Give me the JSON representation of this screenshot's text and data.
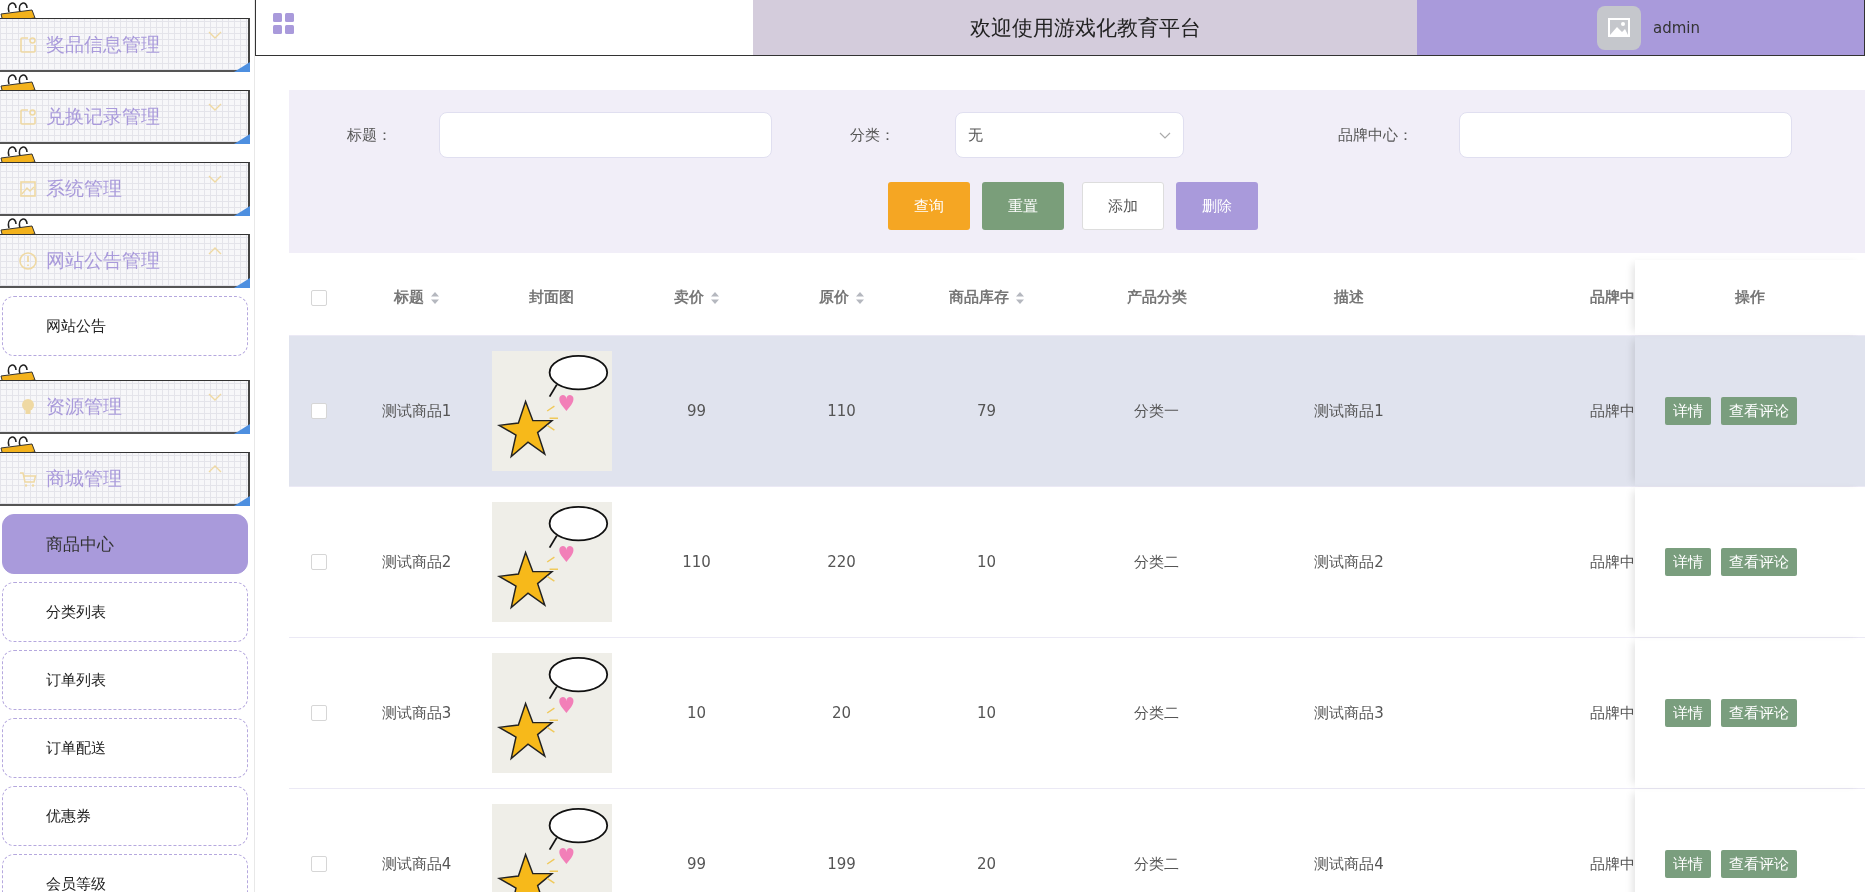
{
  "header": {
    "title": "欢迎使用游戏化教育平台",
    "user": "admin"
  },
  "sidebar": {
    "groups": [
      {
        "label": "奖品信息管理",
        "expanded": false
      },
      {
        "label": "兑换记录管理",
        "expanded": false
      },
      {
        "label": "系统管理",
        "expanded": false
      },
      {
        "label": "网站公告管理",
        "expanded": true,
        "children": [
          {
            "label": "网站公告",
            "selected": false
          }
        ]
      },
      {
        "label": "资源管理",
        "expanded": false
      },
      {
        "label": "商城管理",
        "expanded": true,
        "children": [
          {
            "label": "商品中心",
            "selected": true
          },
          {
            "label": "分类列表",
            "selected": false
          },
          {
            "label": "订单列表",
            "selected": false
          },
          {
            "label": "订单配送",
            "selected": false
          },
          {
            "label": "优惠券",
            "selected": false
          },
          {
            "label": "会员等级",
            "selected": false
          }
        ]
      }
    ]
  },
  "filter": {
    "fields": [
      {
        "kind": "input",
        "label": "标题："
      },
      {
        "kind": "select",
        "label": "分类：",
        "value": "无"
      },
      {
        "kind": "input",
        "label": "品牌中心："
      }
    ],
    "buttons": [
      {
        "kind": "primary",
        "label": "查询"
      },
      {
        "kind": "reset",
        "label": "重置"
      },
      {
        "kind": "plain",
        "label": "添加"
      },
      {
        "kind": "danger",
        "label": "删除"
      }
    ]
  },
  "table": {
    "all_checked": false,
    "columns": [
      {
        "label": "标题",
        "sortable": true
      },
      {
        "label": "封面图",
        "sortable": false
      },
      {
        "label": "卖价",
        "sortable": true
      },
      {
        "label": "原价",
        "sortable": true
      },
      {
        "label": "商品库存",
        "sortable": true
      },
      {
        "label": "产品分类",
        "sortable": false
      },
      {
        "label": "描述",
        "sortable": false
      },
      {
        "label": "品牌中",
        "sortable": false
      },
      {
        "label": "操作",
        "sortable": false
      }
    ],
    "rows": [
      {
        "checked": false,
        "hovered": true,
        "title": "测试商品1",
        "price": "99",
        "original_price": "110",
        "stock": "79",
        "category": "分类一",
        "description": "测试商品1",
        "brand": "品牌中",
        "actions": [
          "详情",
          "查看评论"
        ]
      },
      {
        "checked": false,
        "hovered": false,
        "title": "测试商品2",
        "price": "110",
        "original_price": "220",
        "stock": "10",
        "category": "分类二",
        "description": "测试商品2",
        "brand": "品牌中",
        "actions": [
          "详情",
          "查看评论"
        ]
      },
      {
        "checked": false,
        "hovered": false,
        "title": "测试商品3",
        "price": "10",
        "original_price": "20",
        "stock": "10",
        "category": "分类二",
        "description": "测试商品3",
        "brand": "品牌中",
        "actions": [
          "详情",
          "查看评论"
        ]
      },
      {
        "checked": false,
        "hovered": false,
        "title": "测试商品4",
        "price": "99",
        "original_price": "199",
        "stock": "20",
        "category": "分类二",
        "description": "测试商品4",
        "brand": "品牌中",
        "actions": [
          "详情",
          "查看评论"
        ]
      }
    ]
  }
}
